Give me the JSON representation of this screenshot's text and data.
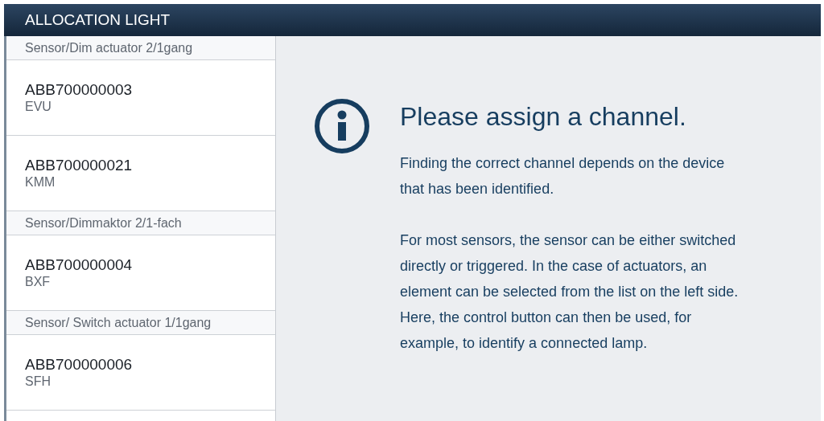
{
  "window": {
    "title": "ALLOCATION LIGHT"
  },
  "sidebar": {
    "groups": [
      {
        "header": "Sensor/Dim actuator 2/1gang",
        "items": [
          {
            "name": "ABB700000003",
            "room": "EVU"
          },
          {
            "name": "ABB700000021",
            "room": "KMM"
          }
        ]
      },
      {
        "header": "Sensor/Dimmaktor 2/1-fach",
        "items": [
          {
            "name": "ABB700000004",
            "room": "BXF"
          }
        ]
      },
      {
        "header": "Sensor/ Switch actuator 1/1gang",
        "items": [
          {
            "name": "ABB700000006",
            "room": "SFH"
          }
        ]
      }
    ]
  },
  "info": {
    "heading": "Please assign a channel.",
    "paragraphs": [
      "Finding the correct channel depends on the device that has been identified.",
      "For most sensors, the sensor can be either switched directly or triggered. In the case of actuators, an element can be selected from the list on the left side. Here, the control button can then be used, for example, to identify a connected lamp."
    ]
  }
}
